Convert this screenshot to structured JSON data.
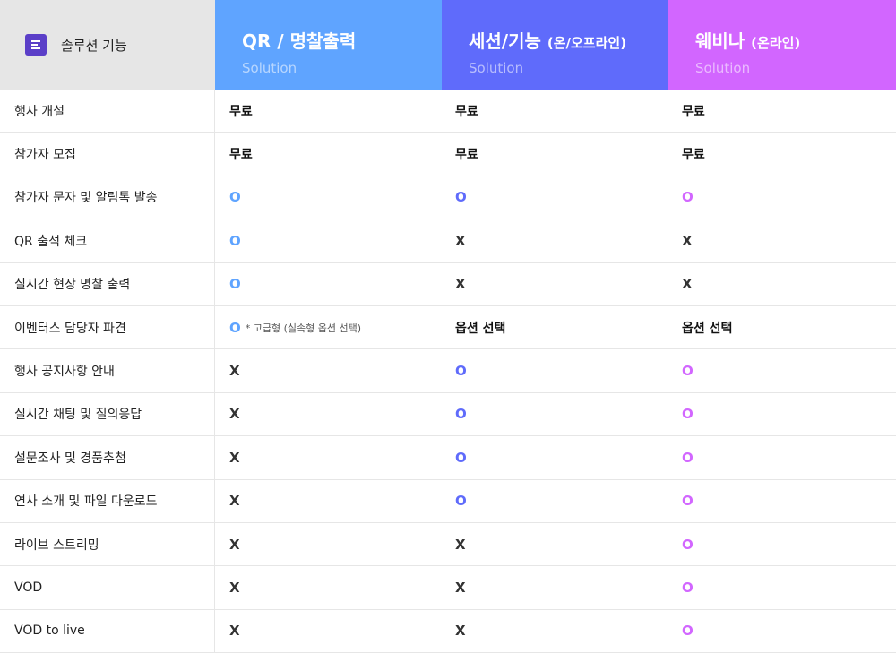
{
  "header": {
    "feature_label": "솔루션 기능",
    "columns": [
      {
        "title": "QR / 명찰출력",
        "sub": "",
        "subtitle": "Solution",
        "color": "#5fa4ff"
      },
      {
        "title": "세션/기능",
        "sub": "(온/오프라인)",
        "subtitle": "Solution",
        "color": "#5f6bfb"
      },
      {
        "title": "웨비나",
        "sub": "(온라인)",
        "subtitle": "Solution",
        "color": "#d266ff"
      }
    ]
  },
  "rows": [
    {
      "feature": "행사 개설",
      "v1": "무료",
      "v2": "무료",
      "v3": "무료"
    },
    {
      "feature": "참가자 모집",
      "v1": "무료",
      "v2": "무료",
      "v3": "무료"
    },
    {
      "feature": "참가자 문자 및 알림톡 발송",
      "v1": "O",
      "v2": "O",
      "v3": "O"
    },
    {
      "feature": "QR 출석 체크",
      "v1": "O",
      "v2": "X",
      "v3": "X"
    },
    {
      "feature": "실시간 현장 명찰 출력",
      "v1": "O",
      "v2": "X",
      "v3": "X"
    },
    {
      "feature": "이벤터스 담당자 파견",
      "v1": "O",
      "v1_note": "* 고급형 (실속형 옵션 선택)",
      "v2": "옵션 선택",
      "v3": "옵션 선택"
    },
    {
      "feature": "행사 공지사항 안내",
      "v1": "X",
      "v2": "O",
      "v3": "O"
    },
    {
      "feature": "실시간 채팅 및 질의응답",
      "v1": "X",
      "v2": "O",
      "v3": "O"
    },
    {
      "feature": "설문조사 및 경품추첨",
      "v1": "X",
      "v2": "O",
      "v3": "O"
    },
    {
      "feature": "연사 소개 및 파일 다운로드",
      "v1": "X",
      "v2": "O",
      "v3": "O"
    },
    {
      "feature": "라이브 스트리밍",
      "v1": "X",
      "v2": "X",
      "v3": "O"
    },
    {
      "feature": "VOD",
      "v1": "X",
      "v2": "X",
      "v3": "O"
    },
    {
      "feature": "VOD to live",
      "v1": "X",
      "v2": "X",
      "v3": "O"
    }
  ]
}
